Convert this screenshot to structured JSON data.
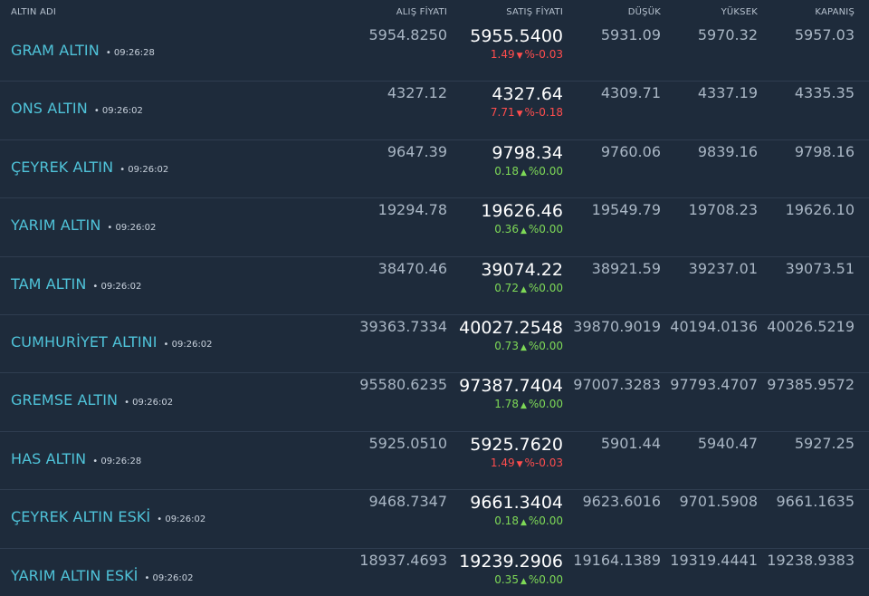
{
  "header": {
    "name": "ALTIN ADI",
    "buy": "ALIŞ FİYATI",
    "sell": "SATIŞ FİYATI",
    "low": "DÜŞÜK",
    "high": "YÜKSEK",
    "close": "KAPANIŞ"
  },
  "colors": {
    "background": "#1e2b3b",
    "name": "#4fc3d9",
    "up": "#7ed957",
    "down": "#ff4d4d"
  },
  "rows": [
    {
      "name": "GRAM ALTIN",
      "time": "• 09:26:28",
      "buy": "5954.8250",
      "sell": "5955.5400",
      "change": "1.49",
      "percent": "%-0.03",
      "dir": "down",
      "low": "5931.09",
      "high": "5970.32",
      "close": "5957.03"
    },
    {
      "name": "ONS ALTIN",
      "time": "• 09:26:02",
      "buy": "4327.12",
      "sell": "4327.64",
      "change": "7.71",
      "percent": "%-0.18",
      "dir": "down",
      "low": "4309.71",
      "high": "4337.19",
      "close": "4335.35"
    },
    {
      "name": "ÇEYREK ALTIN",
      "time": "• 09:26:02",
      "buy": "9647.39",
      "sell": "9798.34",
      "change": "0.18",
      "percent": "%0.00",
      "dir": "up",
      "low": "9760.06",
      "high": "9839.16",
      "close": "9798.16"
    },
    {
      "name": "YARIM ALTIN",
      "time": "• 09:26:02",
      "buy": "19294.78",
      "sell": "19626.46",
      "change": "0.36",
      "percent": "%0.00",
      "dir": "up",
      "low": "19549.79",
      "high": "19708.23",
      "close": "19626.10"
    },
    {
      "name": "TAM ALTIN",
      "time": "• 09:26:02",
      "buy": "38470.46",
      "sell": "39074.22",
      "change": "0.72",
      "percent": "%0.00",
      "dir": "up",
      "low": "38921.59",
      "high": "39237.01",
      "close": "39073.51"
    },
    {
      "name": "CUMHURİYET ALTINI",
      "time": "• 09:26:02",
      "buy": "39363.7334",
      "sell": "40027.2548",
      "change": "0.73",
      "percent": "%0.00",
      "dir": "up",
      "low": "39870.9019",
      "high": "40194.0136",
      "close": "40026.5219"
    },
    {
      "name": "GREMSE ALTIN",
      "time": "• 09:26:02",
      "buy": "95580.6235",
      "sell": "97387.7404",
      "change": "1.78",
      "percent": "%0.00",
      "dir": "up",
      "low": "97007.3283",
      "high": "97793.4707",
      "close": "97385.9572"
    },
    {
      "name": "HAS ALTIN",
      "time": "• 09:26:28",
      "buy": "5925.0510",
      "sell": "5925.7620",
      "change": "1.49",
      "percent": "%-0.03",
      "dir": "down",
      "low": "5901.44",
      "high": "5940.47",
      "close": "5927.25"
    },
    {
      "name": "ÇEYREK ALTIN ESKİ",
      "time": "• 09:26:02",
      "buy": "9468.7347",
      "sell": "9661.3404",
      "change": "0.18",
      "percent": "%0.00",
      "dir": "up",
      "low": "9623.6016",
      "high": "9701.5908",
      "close": "9661.1635"
    },
    {
      "name": "YARIM ALTIN ESKİ",
      "time": "• 09:26:02",
      "buy": "18937.4693",
      "sell": "19239.2906",
      "change": "0.35",
      "percent": "%0.00",
      "dir": "up",
      "low": "19164.1389",
      "high": "19319.4441",
      "close": "19238.9383"
    }
  ]
}
